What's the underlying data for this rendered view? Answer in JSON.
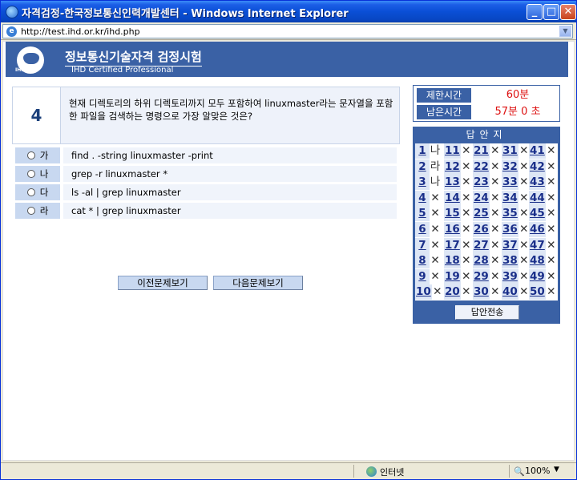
{
  "window": {
    "title": "자격검정-한국정보통신인력개발센터 - Windows Internet Explorer",
    "minimize": "_",
    "maximize": "□",
    "close": "✕"
  },
  "address": {
    "url": "http://test.ihd.or.kr/ihd.php",
    "icon": "e"
  },
  "header": {
    "logo_text": "IHD-CP",
    "title": "정보통신기술자격 검정시험",
    "subtitle": "IHD Certified Professional"
  },
  "question": {
    "number": "4",
    "text": "현재 디렉토리의 하위 디렉토리까지 모두 포함하여 linuxmaster라는 문자열을 포함한 파일을 검색하는 명령으로 가장 알맞은 것은?"
  },
  "options": [
    {
      "label": "가",
      "text": "find . -string linuxmaster -print"
    },
    {
      "label": "나",
      "text": "grep -r linuxmaster *"
    },
    {
      "label": "다",
      "text": "ls -al | grep linuxmaster"
    },
    {
      "label": "라",
      "text": "cat * | grep linuxmaster"
    }
  ],
  "nav": {
    "prev": "이전문제보기",
    "next": "다음문제보기"
  },
  "timer": {
    "limit_label": "제한시간",
    "limit_value": "60분",
    "remain_label": "남은시간",
    "remain_value": "57분 0 초"
  },
  "sheet": {
    "title": "답안지",
    "submit": "답안전송",
    "answers": [
      {
        "n": "1",
        "a": "나"
      },
      {
        "n": "2",
        "a": "라"
      },
      {
        "n": "3",
        "a": "나"
      },
      {
        "n": "4",
        "a": "✕"
      },
      {
        "n": "5",
        "a": "✕"
      },
      {
        "n": "6",
        "a": "✕"
      },
      {
        "n": "7",
        "a": "✕"
      },
      {
        "n": "8",
        "a": "✕"
      },
      {
        "n": "9",
        "a": "✕"
      },
      {
        "n": "10",
        "a": "✕"
      },
      {
        "n": "11",
        "a": "✕"
      },
      {
        "n": "12",
        "a": "✕"
      },
      {
        "n": "13",
        "a": "✕"
      },
      {
        "n": "14",
        "a": "✕"
      },
      {
        "n": "15",
        "a": "✕"
      },
      {
        "n": "16",
        "a": "✕"
      },
      {
        "n": "17",
        "a": "✕"
      },
      {
        "n": "18",
        "a": "✕"
      },
      {
        "n": "19",
        "a": "✕"
      },
      {
        "n": "20",
        "a": "✕"
      },
      {
        "n": "21",
        "a": "✕"
      },
      {
        "n": "22",
        "a": "✕"
      },
      {
        "n": "23",
        "a": "✕"
      },
      {
        "n": "24",
        "a": "✕"
      },
      {
        "n": "25",
        "a": "✕"
      },
      {
        "n": "26",
        "a": "✕"
      },
      {
        "n": "27",
        "a": "✕"
      },
      {
        "n": "28",
        "a": "✕"
      },
      {
        "n": "29",
        "a": "✕"
      },
      {
        "n": "30",
        "a": "✕"
      },
      {
        "n": "31",
        "a": "✕"
      },
      {
        "n": "32",
        "a": "✕"
      },
      {
        "n": "33",
        "a": "✕"
      },
      {
        "n": "34",
        "a": "✕"
      },
      {
        "n": "35",
        "a": "✕"
      },
      {
        "n": "36",
        "a": "✕"
      },
      {
        "n": "37",
        "a": "✕"
      },
      {
        "n": "38",
        "a": "✕"
      },
      {
        "n": "39",
        "a": "✕"
      },
      {
        "n": "40",
        "a": "✕"
      },
      {
        "n": "41",
        "a": "✕"
      },
      {
        "n": "42",
        "a": "✕"
      },
      {
        "n": "43",
        "a": "✕"
      },
      {
        "n": "44",
        "a": "✕"
      },
      {
        "n": "45",
        "a": "✕"
      },
      {
        "n": "46",
        "a": "✕"
      },
      {
        "n": "47",
        "a": "✕"
      },
      {
        "n": "48",
        "a": "✕"
      },
      {
        "n": "49",
        "a": "✕"
      },
      {
        "n": "50",
        "a": "✕"
      }
    ]
  },
  "status": {
    "zone": "인터넷",
    "zoom": "100%",
    "zoom_arrow": "▼",
    "zoom_icon": "🔍"
  }
}
